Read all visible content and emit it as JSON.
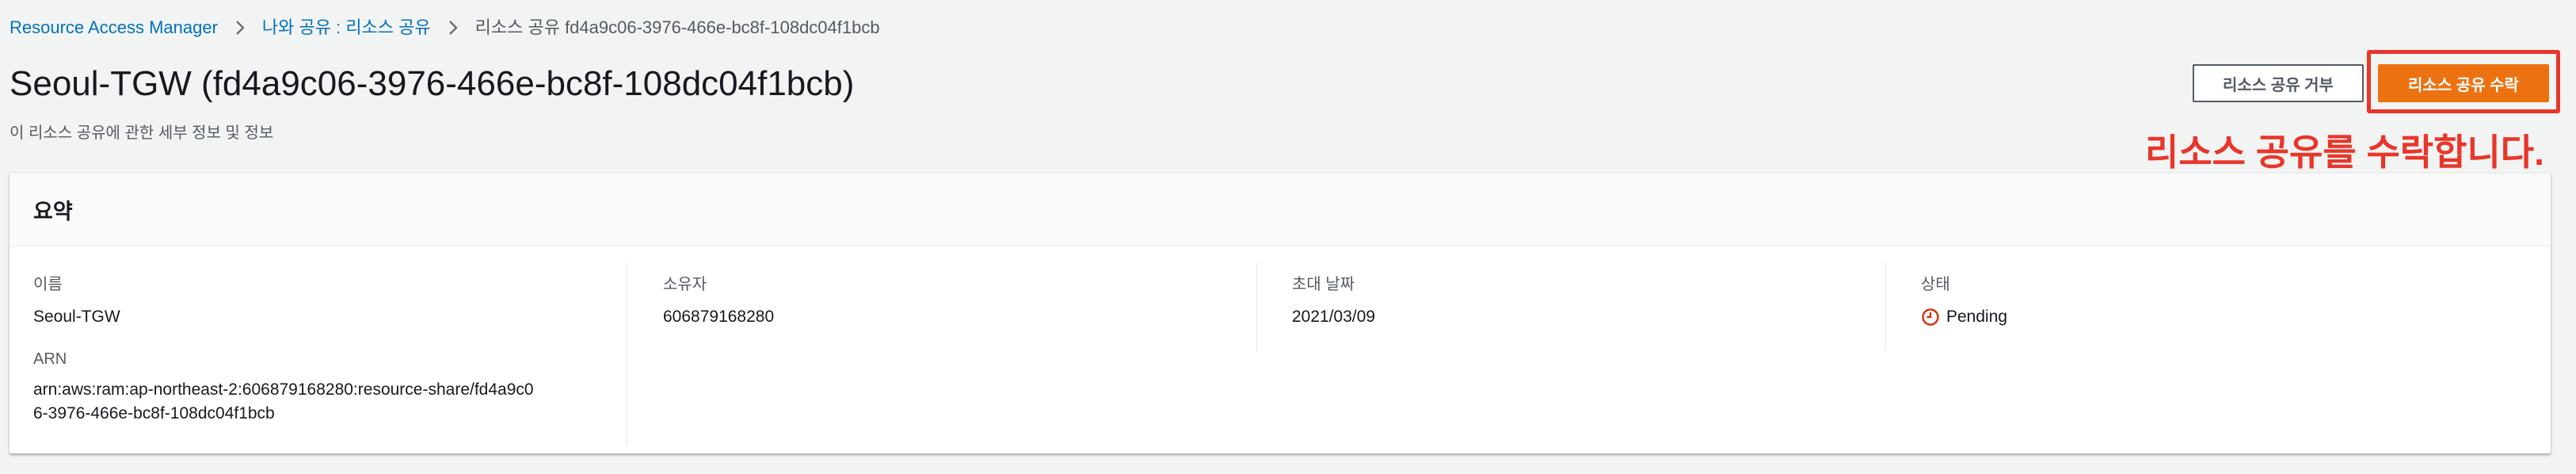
{
  "breadcrumb": {
    "items": [
      {
        "label": "Resource Access Manager"
      },
      {
        "label": "나와 공유 : 리소스 공유"
      },
      {
        "label": "리소스 공유 fd4a9c06-3976-466e-bc8f-108dc04f1bcb"
      }
    ]
  },
  "header": {
    "title": "Seoul-TGW (fd4a9c06-3976-466e-bc8f-108dc04f1bcb)",
    "description": "이 리소스 공유에 관한 세부 정보 및 정보",
    "reject_label": "리소스 공유 거부",
    "accept_label": "리소스 공유 수락"
  },
  "annotation": {
    "text": "리소스 공유를 수락합니다."
  },
  "summary": {
    "title": "요약",
    "name_label": "이름",
    "name_value": "Seoul-TGW",
    "arn_label": "ARN",
    "arn_value": "arn:aws:ram:ap-northeast-2:606879168280:resource-share/fd4a9c06-3976-466e-bc8f-108dc04f1bcb",
    "owner_label": "소유자",
    "owner_value": "606879168280",
    "invite_date_label": "초대 날짜",
    "invite_date_value": "2021/03/09",
    "status_label": "상태",
    "status_value": "Pending"
  },
  "colors": {
    "link": "#0073bb",
    "accent": "#ec7211",
    "annotation": "#e8362a",
    "pending": "#d13212"
  },
  "icons": {
    "separator": "chevron-right-icon",
    "status": "clock-icon"
  }
}
